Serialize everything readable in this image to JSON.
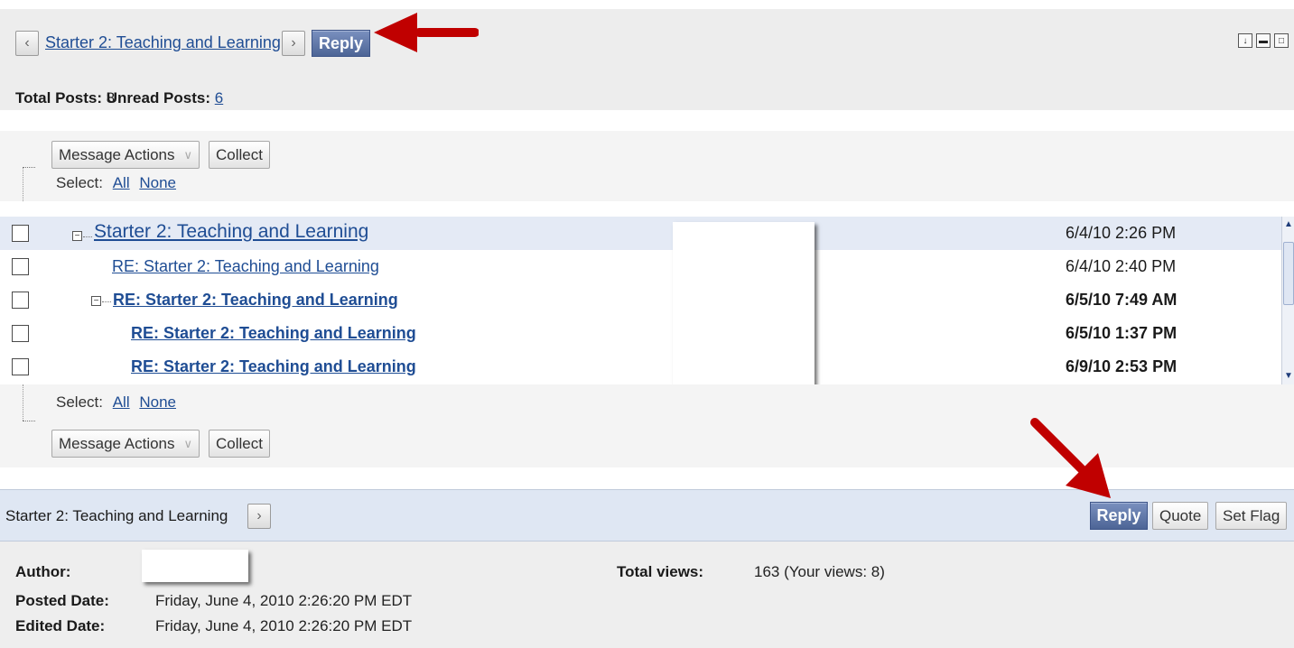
{
  "header": {
    "thread_title": "Starter 2: Teaching and Learning",
    "reply_label": "Reply",
    "prev_icon": "chevron-left-icon",
    "next_icon": "chevron-right-icon",
    "window_icons": [
      "download-icon",
      "minimize-icon",
      "maximize-icon"
    ]
  },
  "counts": {
    "total_label": "Total Posts:",
    "total_value": "8",
    "unread_label": "Unread Posts:",
    "unread_value": "6"
  },
  "actions": {
    "message_actions_label": "Message Actions",
    "collect_label": "Collect",
    "select_label": "Select:",
    "all_label": "All",
    "none_label": "None"
  },
  "posts": [
    {
      "title": "Starter 2: Teaching and Learning",
      "date": "6/4/10 2:26 PM",
      "unread": false,
      "selected": true
    },
    {
      "title": "RE: Starter 2: Teaching and Learning",
      "date": "6/4/10 2:40 PM",
      "unread": false,
      "selected": false
    },
    {
      "title": "RE: Starter 2: Teaching and Learning",
      "date": "6/5/10 7:49 AM",
      "unread": true,
      "selected": false
    },
    {
      "title": "RE: Starter 2: Teaching and Learning",
      "date": "6/5/10 1:37 PM",
      "unread": true,
      "selected": false
    },
    {
      "title": "RE: Starter 2: Teaching and Learning",
      "date": "6/9/10 2:53 PM",
      "unread": true,
      "selected": false
    }
  ],
  "message": {
    "title": "Starter 2: Teaching and Learning",
    "reply_label": "Reply",
    "quote_label": "Quote",
    "flag_label": "Set Flag",
    "author_label": "Author:",
    "posted_label": "Posted Date:",
    "posted_value": "Friday, June 4, 2010 2:26:20 PM EDT",
    "edited_label": "Edited Date:",
    "edited_value": "Friday, June 4, 2010 2:26:20 PM EDT",
    "views_label": "Total views:",
    "views_value": "163 (Your views: 8)"
  },
  "colors": {
    "reply_button": "#5b73a6",
    "link": "#1f4d94",
    "annotation_arrow": "#c00000"
  }
}
